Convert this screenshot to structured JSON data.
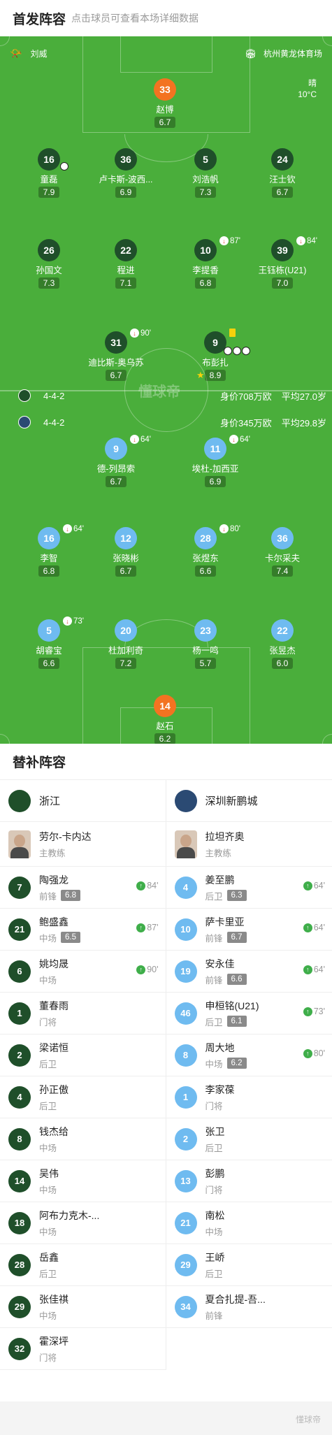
{
  "header": {
    "title": "首发阵容",
    "subtitle": "点击球员可查看本场详细数据"
  },
  "match": {
    "referee": "刘威",
    "stadium": "杭州黄龙体育场",
    "weather": "晴",
    "temperature": "10°C",
    "watermark": "懂球帝"
  },
  "home": {
    "formation": "4-4-2",
    "market_value": "身价708万欧",
    "avg_age": "平均27.0岁",
    "name": "浙江"
  },
  "away": {
    "formation": "4-4-2",
    "market_value": "身价345万欧",
    "avg_age": "平均29.8岁",
    "name": "深圳新鹏城"
  },
  "home_players": [
    {
      "num": "33",
      "name": "赵博",
      "rating": "6.7"
    },
    {
      "num": "16",
      "name": "童磊",
      "rating": "7.9"
    },
    {
      "num": "36",
      "name": "卢卡斯-波西...",
      "rating": "6.9"
    },
    {
      "num": "5",
      "name": "刘浩帆",
      "rating": "7.3"
    },
    {
      "num": "24",
      "name": "汪士钦",
      "rating": "6.7"
    },
    {
      "num": "26",
      "name": "孙国文",
      "rating": "7.3"
    },
    {
      "num": "22",
      "name": "程进",
      "rating": "7.1"
    },
    {
      "num": "10",
      "name": "李提香",
      "rating": "6.8",
      "sub": "87'"
    },
    {
      "num": "39",
      "name": "王钰栋(U21)",
      "rating": "7.0",
      "sub": "84'"
    },
    {
      "num": "31",
      "name": "迪比斯-奥乌苏",
      "rating": "6.7",
      "sub": "90'"
    },
    {
      "num": "9",
      "name": "布彭扎",
      "rating": "8.9"
    }
  ],
  "away_players": [
    {
      "num": "9",
      "name": "德-列昂索",
      "rating": "6.7",
      "sub": "64'"
    },
    {
      "num": "11",
      "name": "埃杜-加西亚",
      "rating": "6.9",
      "sub": "64'"
    },
    {
      "num": "16",
      "name": "李智",
      "rating": "6.8",
      "sub": "64'"
    },
    {
      "num": "12",
      "name": "张晓彬",
      "rating": "6.7"
    },
    {
      "num": "28",
      "name": "张煜东",
      "rating": "6.6",
      "sub": "80'"
    },
    {
      "num": "36",
      "name": "卡尔采夫",
      "rating": "7.4"
    },
    {
      "num": "5",
      "name": "胡睿宝",
      "rating": "6.6",
      "sub": "73'"
    },
    {
      "num": "20",
      "name": "杜加利奇",
      "rating": "7.2"
    },
    {
      "num": "23",
      "name": "杨一鸣",
      "rating": "5.7"
    },
    {
      "num": "22",
      "name": "张昱杰",
      "rating": "6.0"
    },
    {
      "num": "14",
      "name": "赵石",
      "rating": "6.2"
    }
  ],
  "subs": {
    "title": "替补阵容",
    "home_coach": {
      "name": "劳尔-卡内达",
      "role": "主教练"
    },
    "away_coach": {
      "name": "拉坦齐奥",
      "role": "主教练"
    },
    "home": [
      {
        "num": "7",
        "name": "陶强龙",
        "pos": "前锋",
        "rating": "6.8",
        "in": "84'"
      },
      {
        "num": "21",
        "name": "鲍盛鑫",
        "pos": "中场",
        "rating": "6.5",
        "in": "87'"
      },
      {
        "num": "6",
        "name": "姚均晟",
        "pos": "中场",
        "in": "90'"
      },
      {
        "num": "1",
        "name": "董春雨",
        "pos": "门将"
      },
      {
        "num": "2",
        "name": "梁诺恒",
        "pos": "后卫"
      },
      {
        "num": "4",
        "name": "孙正傲",
        "pos": "后卫"
      },
      {
        "num": "8",
        "name": "钱杰给",
        "pos": "中场"
      },
      {
        "num": "14",
        "name": "吴伟",
        "pos": "中场"
      },
      {
        "num": "18",
        "name": "阿布力克木-...",
        "pos": "中场"
      },
      {
        "num": "28",
        "name": "岳鑫",
        "pos": "后卫"
      },
      {
        "num": "29",
        "name": "张佳祺",
        "pos": "中场"
      },
      {
        "num": "32",
        "name": "霍深坪",
        "pos": "门将"
      }
    ],
    "away": [
      {
        "num": "4",
        "name": "姜至鹏",
        "pos": "后卫",
        "rating": "6.3",
        "in": "64'"
      },
      {
        "num": "10",
        "name": "萨卡里亚",
        "pos": "前锋",
        "rating": "6.7",
        "in": "64'"
      },
      {
        "num": "19",
        "name": "安永佳",
        "pos": "前锋",
        "rating": "6.6",
        "in": "64'"
      },
      {
        "num": "46",
        "name": "申桓铭(U21)",
        "pos": "后卫",
        "rating": "6.1",
        "in": "73'"
      },
      {
        "num": "8",
        "name": "周大地",
        "pos": "中场",
        "rating": "6.2",
        "in": "80'"
      },
      {
        "num": "1",
        "name": "李家葆",
        "pos": "门将"
      },
      {
        "num": "2",
        "name": "张卫",
        "pos": "后卫"
      },
      {
        "num": "13",
        "name": "彭鹏",
        "pos": "门将"
      },
      {
        "num": "21",
        "name": "南松",
        "pos": "中场"
      },
      {
        "num": "29",
        "name": "王峤",
        "pos": "后卫"
      },
      {
        "num": "34",
        "name": "夏合扎提-吾...",
        "pos": "前锋"
      }
    ]
  }
}
